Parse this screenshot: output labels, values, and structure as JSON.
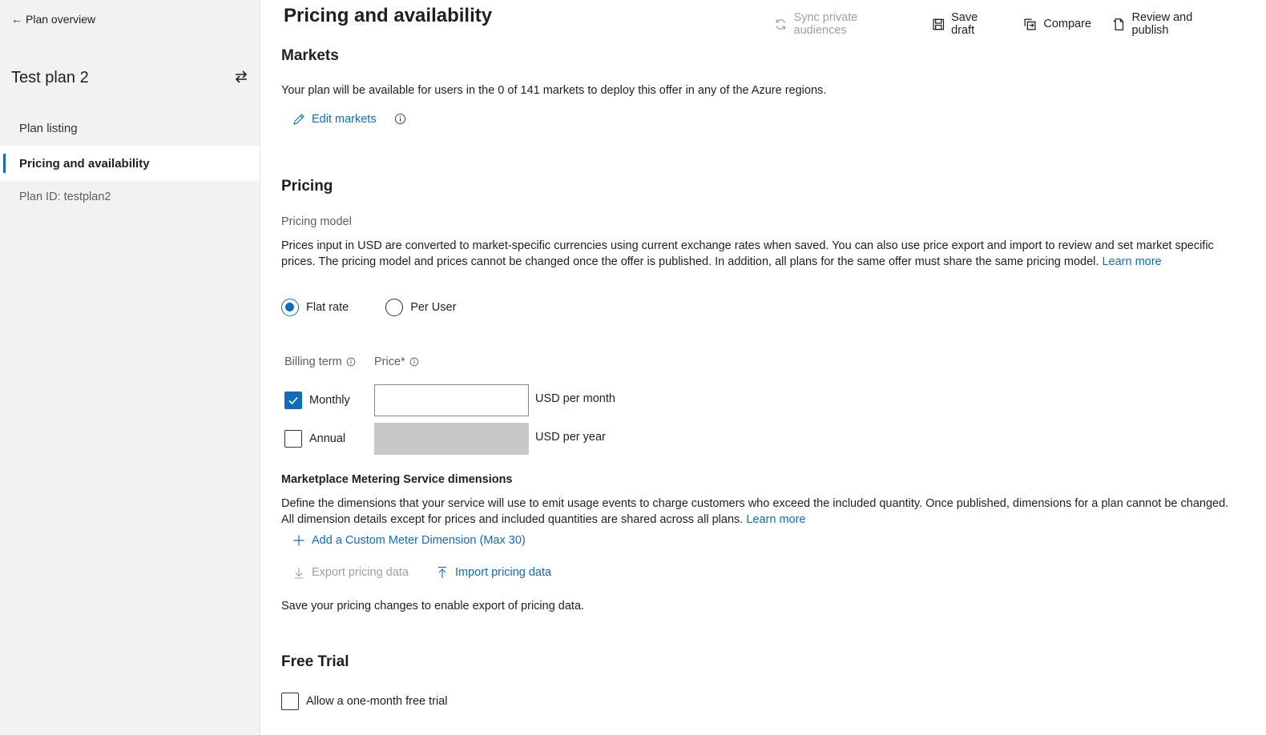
{
  "sidebar": {
    "back_label": "Plan overview",
    "plan_name": "Test plan 2",
    "items": [
      {
        "label": "Plan listing"
      },
      {
        "label": "Pricing and availability"
      }
    ],
    "plan_id": "Plan ID: testplan2"
  },
  "header": {
    "title": "Pricing and availability",
    "toolbar": {
      "sync": "Sync private audiences",
      "save": "Save draft",
      "compare": "Compare",
      "publish": "Review and publish"
    }
  },
  "markets": {
    "heading": "Markets",
    "description": "Your plan will be available for users in the 0 of 141 markets to deploy this offer in any of the Azure regions.",
    "edit_label": "Edit markets"
  },
  "pricing": {
    "heading": "Pricing",
    "model_label": "Pricing model",
    "description": "Prices input in USD are converted to market-specific currencies using current exchange rates when saved. You can also use price export and import to review and set market specific prices. The pricing model and prices cannot be changed once the offer is published. In addition, all plans for the same offer must share the same pricing model.",
    "learn_more": "Learn more",
    "options": [
      {
        "label": "Flat rate",
        "selected": true
      },
      {
        "label": "Per User",
        "selected": false
      }
    ],
    "billing_term_label": "Billing term",
    "price_label": "Price",
    "price_required": "*",
    "terms": [
      {
        "label": "Monthly",
        "checked": true,
        "value": "",
        "unit": "USD per month"
      },
      {
        "label": "Annual",
        "checked": false,
        "value": "",
        "unit": "USD per year"
      }
    ]
  },
  "metering": {
    "heading": "Marketplace Metering Service dimensions",
    "description": "Define the dimensions that your service will use to emit usage events to charge customers who exceed the included quantity. Once published, dimensions for a plan cannot be changed. All dimension details except for prices and included quantities are shared across all plans.",
    "learn_more": "Learn more",
    "add_dimension": "Add a Custom Meter Dimension (Max 30)",
    "export": "Export pricing data",
    "import": "Import pricing data",
    "note": "Save your pricing changes to enable export of pricing data."
  },
  "free_trial": {
    "heading": "Free Trial",
    "option": "Allow a one-month free trial",
    "checked": false
  },
  "colors": {
    "accent": "#0f6cbd",
    "sidebar_bg": "#f3f2f1",
    "disabled_input": "#c8c8c8"
  }
}
